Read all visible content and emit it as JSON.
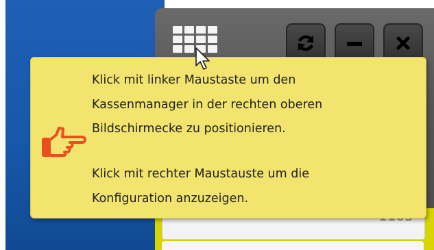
{
  "tooltip": {
    "lines": [
      "Klick mit linker Maustaste um den",
      "Kassenmanager in der rechten oberen",
      "Bildschirmecke zu positionieren.",
      "Klick mit rechter Maustauste um die",
      "Konfiguration anzuzeigen."
    ],
    "icon": "hand-pointing-right-icon"
  },
  "window": {
    "buttons": [
      "refresh-icon",
      "minimize-icon",
      "close-icon"
    ],
    "grid_icon": "grid-icon"
  },
  "app": {
    "field_value": "1105"
  },
  "colors": {
    "desktop": "#1758ab",
    "tooltip_bg": "#f2e46e",
    "hand": "#e8511e",
    "panel": "#d8d400"
  }
}
